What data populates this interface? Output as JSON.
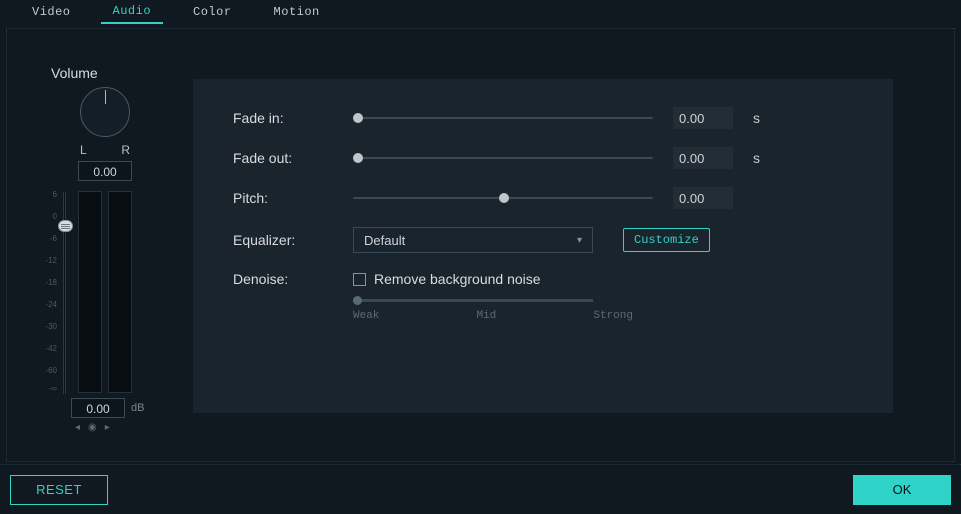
{
  "tabs": {
    "video": "Video",
    "audio": "Audio",
    "color": "Color",
    "motion": "Motion"
  },
  "volume": {
    "title": "Volume",
    "l": "L",
    "r": "R",
    "pan_value": "0.00",
    "db_value": "0.00",
    "db_unit": "dB",
    "ticks": [
      "6",
      "0",
      "-6",
      "-12",
      "-18",
      "-24",
      "-30",
      "-42",
      "-60",
      "-∞"
    ]
  },
  "settings": {
    "fade_in_label": "Fade in:",
    "fade_in_value": "0.00",
    "fade_in_unit": "s",
    "fade_out_label": "Fade out:",
    "fade_out_value": "0.00",
    "fade_out_unit": "s",
    "pitch_label": "Pitch:",
    "pitch_value": "0.00",
    "equalizer_label": "Equalizer:",
    "equalizer_selected": "Default",
    "customize": "Customize",
    "denoise_label": "Denoise:",
    "denoise_checkbox_label": "Remove background noise",
    "strength": {
      "weak": "Weak",
      "mid": "Mid",
      "strong": "Strong"
    }
  },
  "footer": {
    "reset": "RESET",
    "ok": "OK"
  }
}
